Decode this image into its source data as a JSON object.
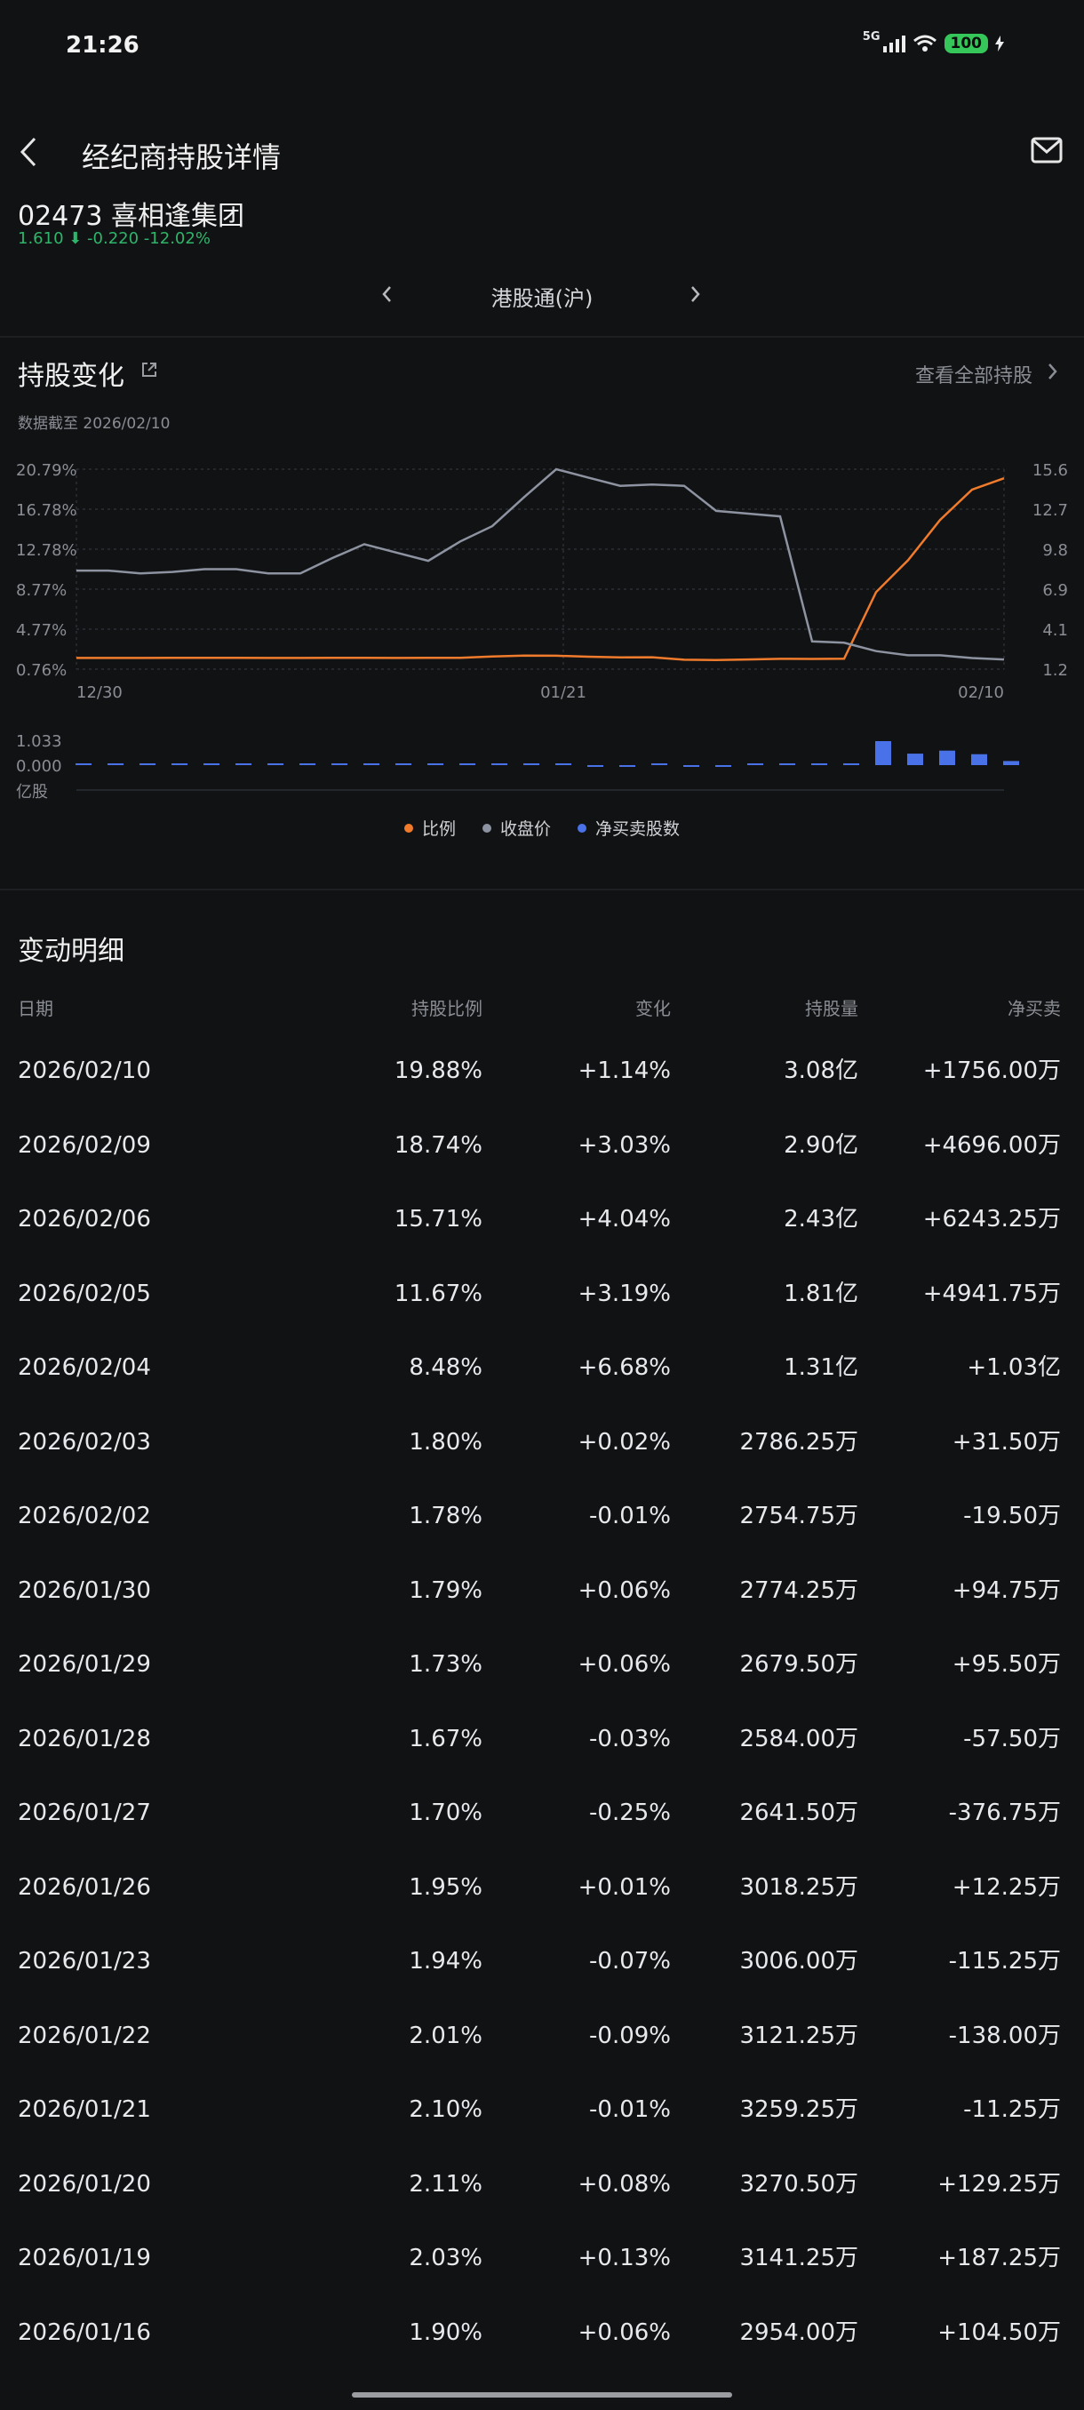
{
  "status": {
    "time": "21:26",
    "network": "5G",
    "battery": "100"
  },
  "header": {
    "title": "经纪商持股详情",
    "back_icon": "back-icon",
    "mail_icon": "mail-icon"
  },
  "stock": {
    "name": "02473  喜相逢集团",
    "quote": "1.610 ⬇ -0.220  -12.02%"
  },
  "selector": {
    "label": "港股通(沪)"
  },
  "holding_change": {
    "title": "持股变化",
    "view_all": "查看全部持股",
    "data_date": "数据截至 2026/02/10"
  },
  "chart_data": {
    "type": "line",
    "x_labels": [
      "12/30",
      "01/21",
      "02/10"
    ],
    "y_left_ticks": [
      "20.79%",
      "16.78%",
      "12.78%",
      "8.77%",
      "4.77%",
      "0.76%"
    ],
    "y_right_ticks": [
      "15.6",
      "12.7",
      "9.8",
      "6.9",
      "4.1",
      "1.2"
    ],
    "bar_ticks": [
      "1.033",
      "0.000",
      "亿股"
    ],
    "dates": [
      "2025/12/30",
      "2025/12/31",
      "2026/01/02",
      "2026/01/05",
      "2026/01/06",
      "2026/01/07",
      "2026/01/08",
      "2026/01/09",
      "2026/01/12",
      "2026/01/13",
      "2026/01/14",
      "2026/01/15",
      "2026/01/16",
      "2026/01/19",
      "2026/01/20",
      "2026/01/21",
      "2026/01/22",
      "2026/01/23",
      "2026/01/26",
      "2026/01/27",
      "2026/01/28",
      "2026/01/29",
      "2026/01/30",
      "2026/02/02",
      "2026/02/03",
      "2026/02/04",
      "2026/02/05",
      "2026/02/06",
      "2026/02/09",
      "2026/02/10"
    ],
    "series": [
      {
        "name": "比例",
        "color": "#f07b2c",
        "axis": "left",
        "values": [
          1.88,
          1.88,
          1.88,
          1.9,
          1.9,
          1.9,
          1.88,
          1.88,
          1.89,
          1.9,
          1.88,
          1.9,
          1.9,
          2.03,
          2.11,
          2.1,
          2.01,
          1.94,
          1.95,
          1.7,
          1.67,
          1.73,
          1.79,
          1.78,
          1.8,
          8.48,
          11.67,
          15.71,
          18.74,
          19.88
        ]
      },
      {
        "name": "收盘价",
        "color": "#8d93a0",
        "axis": "right",
        "values": [
          8.3,
          8.3,
          8.1,
          8.2,
          8.4,
          8.4,
          8.1,
          8.1,
          9.2,
          10.2,
          9.6,
          9.0,
          10.4,
          11.5,
          13.6,
          15.6,
          15.0,
          14.4,
          14.5,
          14.4,
          12.6,
          12.4,
          12.2,
          3.2,
          3.1,
          2.5,
          2.2,
          2.2,
          2.0,
          1.9
        ]
      },
      {
        "name": "净买卖股数",
        "color": "#4a72e8",
        "axis": "bars",
        "unit": "亿股",
        "values": [
          0.001,
          0.001,
          0.002,
          0.002,
          0.002,
          0.003,
          0.003,
          0.002,
          0.002,
          0.003,
          0.002,
          0.001,
          0.001,
          0.002,
          0.001,
          0.0,
          -0.001,
          -0.001,
          0.0,
          -0.004,
          -0.001,
          0.001,
          0.001,
          0.0,
          0.003,
          1.033,
          0.494,
          0.624,
          0.47,
          0.176
        ]
      }
    ],
    "y_left_range": [
      0.76,
      20.79
    ],
    "y_right_range": [
      1.2,
      15.6
    ],
    "bar_range": [
      0,
      1.033
    ]
  },
  "legend": {
    "ratio": "比例",
    "close": "收盘价",
    "net": "净买卖股数"
  },
  "details": {
    "title": "变动明细",
    "columns": [
      "日期",
      "持股比例",
      "变化",
      "持股量",
      "净买卖"
    ],
    "rows": [
      [
        "2026/02/10",
        "19.88%",
        "+1.14%",
        "3.08亿",
        "+1756.00万"
      ],
      [
        "2026/02/09",
        "18.74%",
        "+3.03%",
        "2.90亿",
        "+4696.00万"
      ],
      [
        "2026/02/06",
        "15.71%",
        "+4.04%",
        "2.43亿",
        "+6243.25万"
      ],
      [
        "2026/02/05",
        "11.67%",
        "+3.19%",
        "1.81亿",
        "+4941.75万"
      ],
      [
        "2026/02/04",
        "8.48%",
        "+6.68%",
        "1.31亿",
        "+1.03亿"
      ],
      [
        "2026/02/03",
        "1.80%",
        "+0.02%",
        "2786.25万",
        "+31.50万"
      ],
      [
        "2026/02/02",
        "1.78%",
        "-0.01%",
        "2754.75万",
        "-19.50万"
      ],
      [
        "2026/01/30",
        "1.79%",
        "+0.06%",
        "2774.25万",
        "+94.75万"
      ],
      [
        "2026/01/29",
        "1.73%",
        "+0.06%",
        "2679.50万",
        "+95.50万"
      ],
      [
        "2026/01/28",
        "1.67%",
        "-0.03%",
        "2584.00万",
        "-57.50万"
      ],
      [
        "2026/01/27",
        "1.70%",
        "-0.25%",
        "2641.50万",
        "-376.75万"
      ],
      [
        "2026/01/26",
        "1.95%",
        "+0.01%",
        "3018.25万",
        "+12.25万"
      ],
      [
        "2026/01/23",
        "1.94%",
        "-0.07%",
        "3006.00万",
        "-115.25万"
      ],
      [
        "2026/01/22",
        "2.01%",
        "-0.09%",
        "3121.25万",
        "-138.00万"
      ],
      [
        "2026/01/21",
        "2.10%",
        "-0.01%",
        "3259.25万",
        "-11.25万"
      ],
      [
        "2026/01/20",
        "2.11%",
        "+0.08%",
        "3270.50万",
        "+129.25万"
      ],
      [
        "2026/01/19",
        "2.03%",
        "+0.13%",
        "3141.25万",
        "+187.25万"
      ],
      [
        "2026/01/16",
        "1.90%",
        "+0.06%",
        "2954.00万",
        "+104.50万"
      ]
    ]
  }
}
